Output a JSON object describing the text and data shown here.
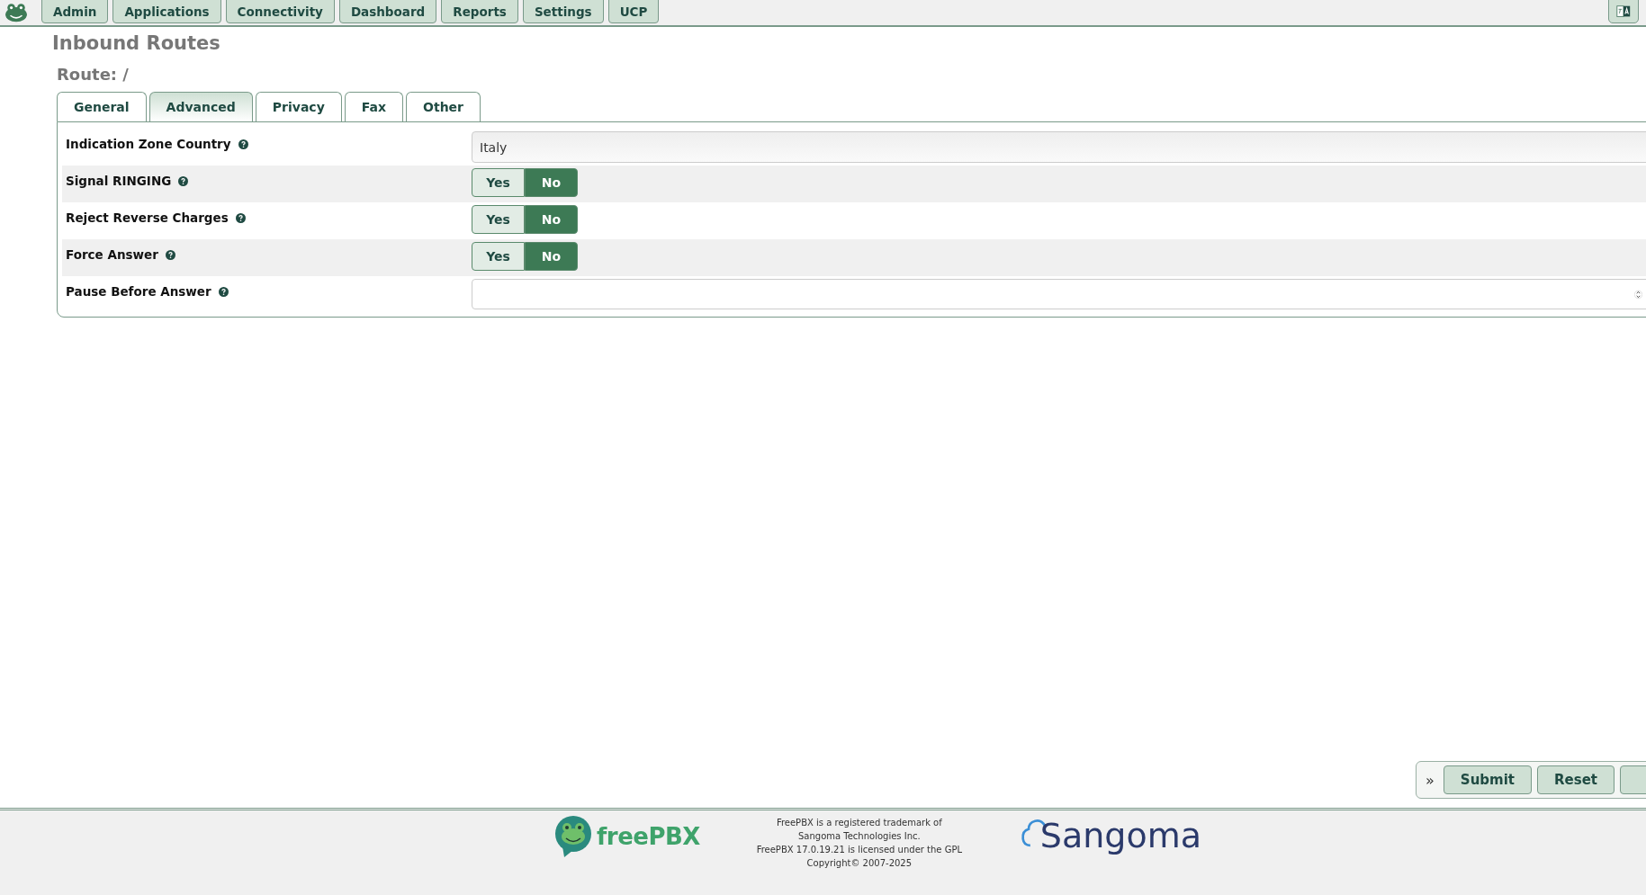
{
  "nav": [
    {
      "label": "Admin"
    },
    {
      "label": "Applications"
    },
    {
      "label": "Connectivity"
    },
    {
      "label": "Dashboard"
    },
    {
      "label": "Reports"
    },
    {
      "label": "Settings"
    },
    {
      "label": "UCP"
    }
  ],
  "page_title": "Inbound Routes",
  "route_title": "Route: /",
  "tabs": [
    {
      "label": "General",
      "selected": false
    },
    {
      "label": "Advanced",
      "selected": true
    },
    {
      "label": "Privacy",
      "selected": false
    },
    {
      "label": "Fax",
      "selected": false
    },
    {
      "label": "Other",
      "selected": false
    }
  ],
  "fields": [
    {
      "kind": "select",
      "label": "Indication Zone Country",
      "value": "Italy"
    },
    {
      "kind": "toggle",
      "label": "Signal RINGING",
      "options": [
        {
          "label": "Yes",
          "selected": false
        },
        {
          "label": "No",
          "selected": true
        }
      ]
    },
    {
      "kind": "toggle",
      "label": "Reject Reverse Charges",
      "options": [
        {
          "label": "Yes",
          "selected": false
        },
        {
          "label": "No",
          "selected": true
        }
      ]
    },
    {
      "kind": "toggle",
      "label": "Force Answer",
      "options": [
        {
          "label": "Yes",
          "selected": false
        },
        {
          "label": "No",
          "selected": true
        }
      ]
    },
    {
      "kind": "number",
      "label": "Pause Before Answer"
    }
  ],
  "actions": {
    "expander": "»",
    "buttons": [
      "Submit",
      "Reset"
    ]
  },
  "footer": {
    "freepbx_logo": "freePBX",
    "lines": [
      "FreePBX is a registered trademark of",
      "Sangoma Technologies Inc.",
      "FreePBX 17.0.19.21 is licensed under the GPL",
      "Copyright© 2007-2025"
    ],
    "sangoma_logo": "Sangoma"
  }
}
